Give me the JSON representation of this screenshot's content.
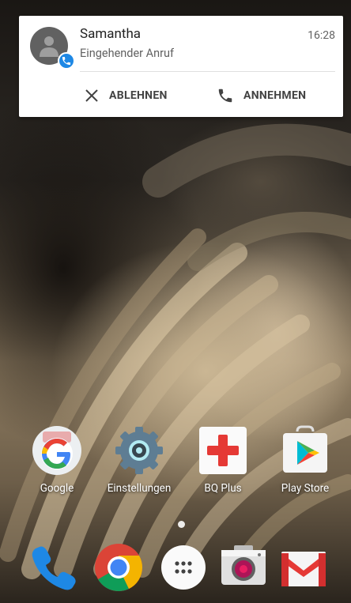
{
  "notification": {
    "caller": "Samantha",
    "subtitle": "Eingehender Anruf",
    "time": "16:28",
    "decline_label": "ABLEHNEN",
    "accept_label": "ANNEHMEN"
  },
  "home_apps": [
    {
      "label": "Google",
      "icon": "google-icon"
    },
    {
      "label": "Einstellungen",
      "icon": "settings-icon"
    },
    {
      "label": "BQ Plus",
      "icon": "bq-plus-icon"
    },
    {
      "label": "Play Store",
      "icon": "play-store-icon"
    }
  ],
  "dock_apps": [
    {
      "icon": "phone-icon"
    },
    {
      "icon": "chrome-icon"
    },
    {
      "icon": "app-drawer-icon"
    },
    {
      "icon": "camera-icon"
    },
    {
      "icon": "gmail-icon"
    }
  ]
}
